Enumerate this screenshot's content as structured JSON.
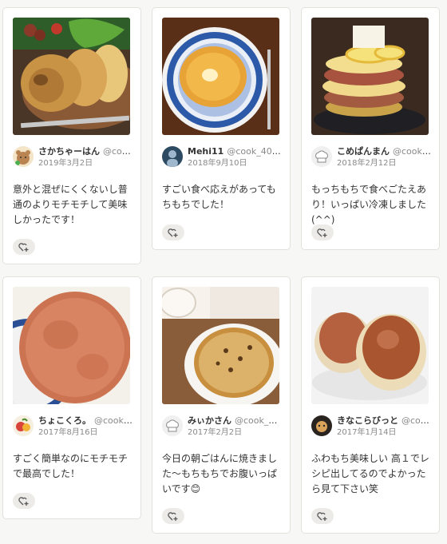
{
  "cards": [
    {
      "name": "さかちゃーはん",
      "id": "@cook_...",
      "date": "2019年3月2日",
      "comment": "意外と混ぜにくくないし普通のよりモチモチして美味しかったです！"
    },
    {
      "name": "Mehi11",
      "id": "@cook_408...",
      "date": "2018年9月10日",
      "comment": "すごい食べ応えがあってもちもちでした！"
    },
    {
      "name": "こめぱんまん",
      "id": "@cook_4...",
      "date": "2018年2月12日",
      "comment": "もっちもちで食べごたえあり！いっぱい冷凍しました(^^)"
    },
    {
      "name": "ちょこくろ。",
      "id": "@cook_40...",
      "date": "2017年8月16日",
      "comment": "すごく簡単なのにモチモチで最高でした！"
    },
    {
      "name": "みぃかさん",
      "id": "@cook_40...",
      "date": "2017年2月2日",
      "comment": "今日の朝ごはんに焼きました〜もちもちでお腹いっぱいです😊"
    },
    {
      "name": "きなこらびっと",
      "id": "@cook_...",
      "date": "2017年1月14日",
      "comment": "ふわもち美味しい 高１でレシピ出してるのでよかったら見て下さい笑"
    }
  ],
  "icons": {
    "like": "heart-plus-icon",
    "avatars": [
      "bear-avatar-icon",
      "person-avatar-icon",
      "chef-hat-icon",
      "fruit-avatar-icon",
      "chef-hat-icon",
      "animal-avatar-icon"
    ]
  },
  "colors": {
    "background": "#f7f7f5",
    "card_border": "#e3e1dc",
    "date_text": "#8a8a8a",
    "like_button_bg": "#ecebe7"
  }
}
